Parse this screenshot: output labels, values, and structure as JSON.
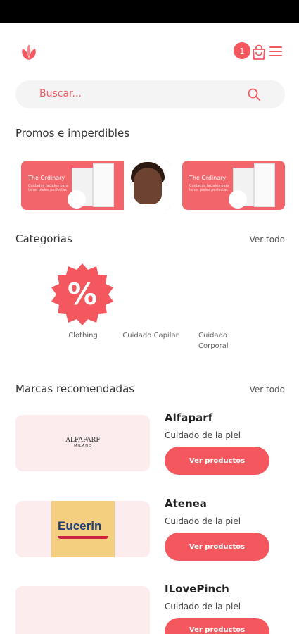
{
  "header": {
    "cart_count": "1"
  },
  "search": {
    "placeholder": "Buscar..."
  },
  "promos": {
    "title": "Promos e imperdibles",
    "items": [
      {
        "brand": "The Ordinary",
        "tagline": "Cuidados faciales para tener pieles perfectas"
      },
      {
        "brand": "The Ordinary",
        "tagline": "Cuidados faciales para tener pieles perfectas"
      }
    ]
  },
  "categories": {
    "title": "Categorias",
    "see_all": "Ver todo",
    "items": [
      "Clothing",
      "Cuidado Capilar",
      "Cuidado Corporal"
    ]
  },
  "brands": {
    "title": "Marcas recomendadas",
    "see_all": "Ver todo",
    "button_label": "Ver productos",
    "items": [
      {
        "name": "Alfaparf",
        "subtitle": "Cuidado de la piel",
        "logo_text": "ALFAPARF",
        "logo_sub": "MILANO"
      },
      {
        "name": "Atenea",
        "subtitle": "Cuidado de la piel",
        "logo_text": "Eucerin"
      },
      {
        "name": "ILovePinch",
        "subtitle": "Cuidado de la piel"
      }
    ]
  },
  "colors": {
    "accent": "#f4575e",
    "card_bg": "#fcecee",
    "search_bg": "#f4f4f4"
  },
  "icons": [
    "leaf-logo-icon",
    "cart-icon",
    "menu-icon",
    "search-icon",
    "percent-badge-icon"
  ]
}
